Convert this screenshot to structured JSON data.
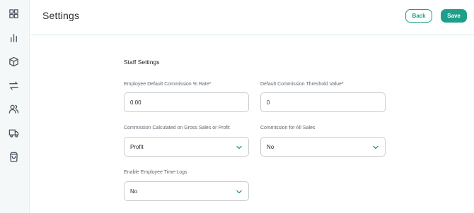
{
  "header": {
    "title": "Settings",
    "back_label": "Back",
    "save_label": "Save"
  },
  "sidebar": {
    "items": [
      {
        "icon": "grid-icon"
      },
      {
        "icon": "bar-chart-icon"
      },
      {
        "icon": "box-icon"
      },
      {
        "icon": "transfer-arrows-icon"
      },
      {
        "icon": "users-icon"
      },
      {
        "icon": "truck-icon"
      },
      {
        "icon": "shopping-bag-icon"
      }
    ]
  },
  "section": {
    "title": "Staff Settings"
  },
  "fields": {
    "commission_rate": {
      "label": "Employee Default Commission % Rate*",
      "value": "0.00"
    },
    "threshold_value": {
      "label": "Default Commission Threshold Value*",
      "value": "0"
    },
    "calc_basis": {
      "label": "Commission Calculated on Gross Sales or Profit",
      "value": "Profit"
    },
    "all_sales": {
      "label": "Commission for All Sales",
      "value": "No"
    },
    "time_logs": {
      "label": "Enable Employee Time-Logs",
      "value": "No"
    }
  },
  "colors": {
    "accent": "#1f9e8a",
    "sidebar_bg": "#f5f8f8",
    "border": "#c9cdd1"
  }
}
